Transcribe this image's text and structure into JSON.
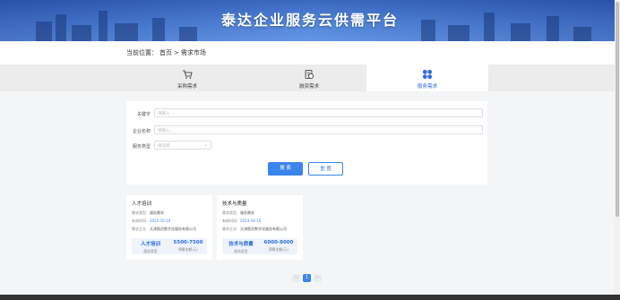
{
  "banner": {
    "title": "泰达企业服务云供需平台"
  },
  "breadcrumb": {
    "prefix": "当前位置：",
    "home": "首页",
    "sep": ">",
    "current": "需求市场"
  },
  "tabs": [
    {
      "label": "采购需求",
      "icon": "cart-icon"
    },
    {
      "label": "融资需求",
      "icon": "finance-icon"
    },
    {
      "label": "服务需求",
      "icon": "grid-clover-icon",
      "active": true
    }
  ],
  "search": {
    "keyword_label": "关键字",
    "keyword_placeholder": "请输入",
    "company_label": "企业名称",
    "company_placeholder": "请输入...",
    "type_label": "服务类型",
    "type_placeholder": "请选择",
    "search_button": "搜 索",
    "reset_button": "重 置"
  },
  "cards": [
    {
      "title": "人才培训",
      "type_label": "需求类型：",
      "type_value": "服务需求",
      "date_label": "有效时间：",
      "date_value": "2023-10-10",
      "company_label": "需求企业：",
      "company_value": "天津图灵数字化服务有限公司",
      "stat1_value": "人才培训",
      "stat1_label": "服务类型",
      "stat2_value": "5500-7500",
      "stat2_label": "预算金额(元)"
    },
    {
      "title": "技术与质量",
      "type_label": "需求类型：",
      "type_value": "服务需求",
      "date_label": "有效时间：",
      "date_value": "2023-10-10",
      "company_label": "需求企业：",
      "company_value": "天津图灵数字化服务有限公司",
      "stat1_value": "技术与质量",
      "stat1_label": "服务类型",
      "stat2_value": "6000-8000",
      "stat2_label": "预算金额(元)"
    }
  ],
  "pagination": {
    "prev": "<",
    "current": "1",
    "next": ">"
  },
  "colors": {
    "accent": "#3a84ee",
    "banner": "#3a6cc8"
  }
}
